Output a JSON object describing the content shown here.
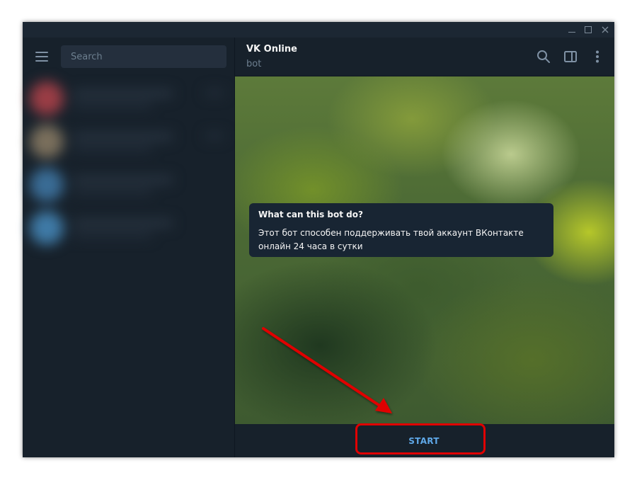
{
  "colors": {
    "window_bg": "#17212b",
    "accent": "#5fa8e8",
    "highlight": "#e00000"
  },
  "titlebar": {
    "minimize_icon": "minimize-icon",
    "maximize_icon": "maximize-icon",
    "close_icon": "close-icon"
  },
  "sidebar": {
    "menu_icon": "hamburger-menu-icon",
    "search_placeholder": "Search"
  },
  "chat": {
    "title": "VK Online",
    "subtitle": "bot",
    "header_icons": [
      "search-icon",
      "side-panel-icon",
      "more-vertical-icon"
    ],
    "bot_info": {
      "title": "What can this bot do?",
      "text": "Этот бот способен поддерживать твой аккаунт ВКонтакте онлайн 24 часа в сутки"
    },
    "start_label": "START"
  }
}
